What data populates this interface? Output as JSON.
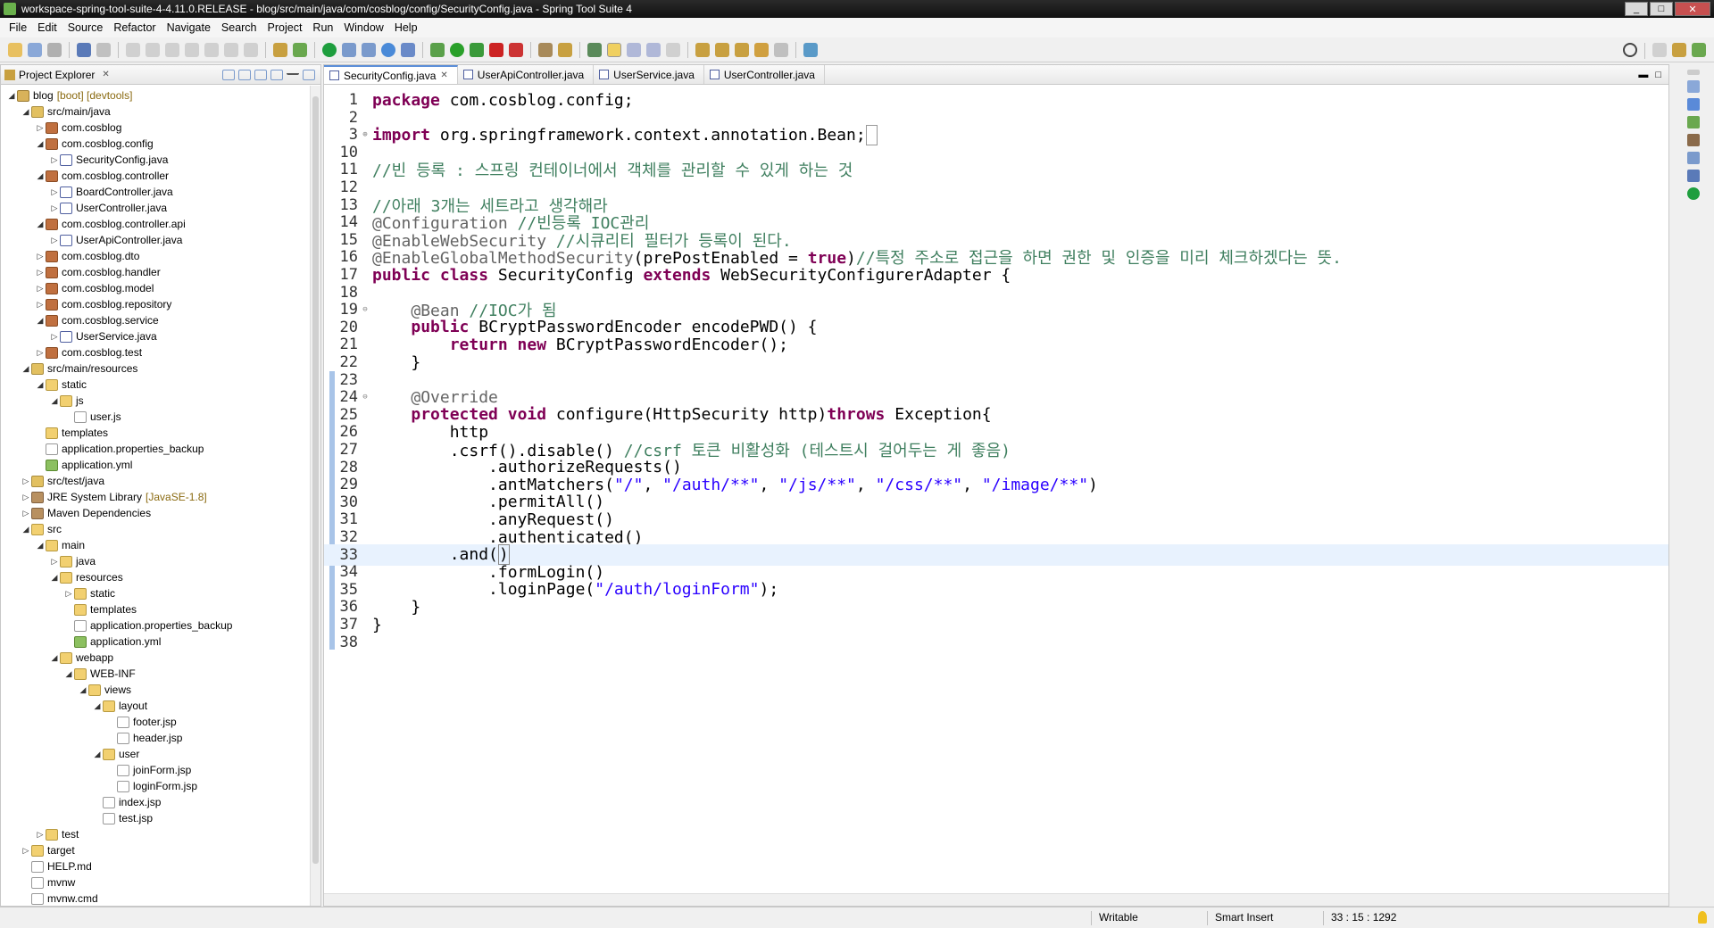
{
  "window": {
    "title": "workspace-spring-tool-suite-4-4.11.0.RELEASE - blog/src/main/java/com/cosblog/config/SecurityConfig.java - Spring Tool Suite 4"
  },
  "menu": [
    "File",
    "Edit",
    "Source",
    "Refactor",
    "Navigate",
    "Search",
    "Project",
    "Run",
    "Window",
    "Help"
  ],
  "explorer": {
    "title": "Project Explorer",
    "tree": [
      {
        "depth": 0,
        "arrow": "◢",
        "icon": "project",
        "label": "blog",
        "dec": "[boot] [devtools]"
      },
      {
        "depth": 1,
        "arrow": "◢",
        "icon": "srcfolder",
        "label": "src/main/java"
      },
      {
        "depth": 2,
        "arrow": "▷",
        "icon": "package",
        "label": "com.cosblog"
      },
      {
        "depth": 2,
        "arrow": "◢",
        "icon": "package",
        "label": "com.cosblog.config"
      },
      {
        "depth": 3,
        "arrow": "▷",
        "icon": "java",
        "label": "SecurityConfig.java"
      },
      {
        "depth": 2,
        "arrow": "◢",
        "icon": "package",
        "label": "com.cosblog.controller"
      },
      {
        "depth": 3,
        "arrow": "▷",
        "icon": "java",
        "label": "BoardController.java"
      },
      {
        "depth": 3,
        "arrow": "▷",
        "icon": "java",
        "label": "UserController.java"
      },
      {
        "depth": 2,
        "arrow": "◢",
        "icon": "package",
        "label": "com.cosblog.controller.api"
      },
      {
        "depth": 3,
        "arrow": "▷",
        "icon": "java",
        "label": "UserApiController.java"
      },
      {
        "depth": 2,
        "arrow": "▷",
        "icon": "package",
        "label": "com.cosblog.dto"
      },
      {
        "depth": 2,
        "arrow": "▷",
        "icon": "package",
        "label": "com.cosblog.handler"
      },
      {
        "depth": 2,
        "arrow": "▷",
        "icon": "package",
        "label": "com.cosblog.model"
      },
      {
        "depth": 2,
        "arrow": "▷",
        "icon": "package",
        "label": "com.cosblog.repository"
      },
      {
        "depth": 2,
        "arrow": "◢",
        "icon": "package",
        "label": "com.cosblog.service"
      },
      {
        "depth": 3,
        "arrow": "▷",
        "icon": "java",
        "label": "UserService.java"
      },
      {
        "depth": 2,
        "arrow": "▷",
        "icon": "package",
        "label": "com.cosblog.test"
      },
      {
        "depth": 1,
        "arrow": "◢",
        "icon": "srcfolder",
        "label": "src/main/resources"
      },
      {
        "depth": 2,
        "arrow": "◢",
        "icon": "folder",
        "label": "static"
      },
      {
        "depth": 3,
        "arrow": "◢",
        "icon": "folder",
        "label": "js"
      },
      {
        "depth": 4,
        "arrow": "",
        "icon": "file",
        "label": "user.js"
      },
      {
        "depth": 2,
        "arrow": "",
        "icon": "folder",
        "label": "templates"
      },
      {
        "depth": 2,
        "arrow": "",
        "icon": "file",
        "label": "application.properties_backup"
      },
      {
        "depth": 2,
        "arrow": "",
        "icon": "yml",
        "label": "application.yml"
      },
      {
        "depth": 1,
        "arrow": "▷",
        "icon": "srcfolder",
        "label": "src/test/java"
      },
      {
        "depth": 1,
        "arrow": "▷",
        "icon": "lib",
        "label": "JRE System Library",
        "dec": "[JavaSE-1.8]"
      },
      {
        "depth": 1,
        "arrow": "▷",
        "icon": "lib",
        "label": "Maven Dependencies"
      },
      {
        "depth": 1,
        "arrow": "◢",
        "icon": "folder",
        "label": "src"
      },
      {
        "depth": 2,
        "arrow": "◢",
        "icon": "folder",
        "label": "main"
      },
      {
        "depth": 3,
        "arrow": "▷",
        "icon": "folder",
        "label": "java"
      },
      {
        "depth": 3,
        "arrow": "◢",
        "icon": "folder",
        "label": "resources"
      },
      {
        "depth": 4,
        "arrow": "▷",
        "icon": "folder",
        "label": "static"
      },
      {
        "depth": 4,
        "arrow": "",
        "icon": "folder",
        "label": "templates"
      },
      {
        "depth": 4,
        "arrow": "",
        "icon": "file",
        "label": "application.properties_backup"
      },
      {
        "depth": 4,
        "arrow": "",
        "icon": "yml",
        "label": "application.yml"
      },
      {
        "depth": 3,
        "arrow": "◢",
        "icon": "folder",
        "label": "webapp"
      },
      {
        "depth": 4,
        "arrow": "◢",
        "icon": "folder",
        "label": "WEB-INF"
      },
      {
        "depth": 5,
        "arrow": "◢",
        "icon": "folder",
        "label": "views"
      },
      {
        "depth": 6,
        "arrow": "◢",
        "icon": "folder",
        "label": "layout"
      },
      {
        "depth": 7,
        "arrow": "",
        "icon": "file",
        "label": "footer.jsp"
      },
      {
        "depth": 7,
        "arrow": "",
        "icon": "file",
        "label": "header.jsp"
      },
      {
        "depth": 6,
        "arrow": "◢",
        "icon": "folder",
        "label": "user"
      },
      {
        "depth": 7,
        "arrow": "",
        "icon": "file",
        "label": "joinForm.jsp"
      },
      {
        "depth": 7,
        "arrow": "",
        "icon": "file",
        "label": "loginForm.jsp"
      },
      {
        "depth": 6,
        "arrow": "",
        "icon": "file",
        "label": "index.jsp"
      },
      {
        "depth": 6,
        "arrow": "",
        "icon": "file",
        "label": "test.jsp"
      },
      {
        "depth": 2,
        "arrow": "▷",
        "icon": "folder",
        "label": "test"
      },
      {
        "depth": 1,
        "arrow": "▷",
        "icon": "folder",
        "label": "target"
      },
      {
        "depth": 1,
        "arrow": "",
        "icon": "file",
        "label": "HELP.md"
      },
      {
        "depth": 1,
        "arrow": "",
        "icon": "file",
        "label": "mvnw"
      },
      {
        "depth": 1,
        "arrow": "",
        "icon": "file",
        "label": "mvnw.cmd"
      }
    ]
  },
  "editor": {
    "tabs": [
      {
        "label": "SecurityConfig.java",
        "active": true
      },
      {
        "label": "UserApiController.java",
        "active": false
      },
      {
        "label": "UserService.java",
        "active": false
      },
      {
        "label": "UserController.java",
        "active": false
      }
    ],
    "lines": [
      {
        "n": "1",
        "html": "<span class=\"kw\">package</span> com.cosblog.config;"
      },
      {
        "n": "2",
        "html": ""
      },
      {
        "n": "3",
        "fold": "⊕",
        "html": "<span class=\"kw\">import</span> org.springframework.context.annotation.Bean;<span style=\"border:1px solid #999\">&nbsp;</span>"
      },
      {
        "n": "10",
        "html": ""
      },
      {
        "n": "11",
        "html": "<span class=\"cm\">//빈 등록 : 스프링 컨테이너에서 객체를 관리할 수 있게 하는 것</span>"
      },
      {
        "n": "12",
        "html": ""
      },
      {
        "n": "13",
        "html": "<span class=\"cm\">//아래 3개는 세트라고 생각해라</span>"
      },
      {
        "n": "14",
        "html": "<span class=\"an\">@Configuration</span> <span class=\"cm\">//빈등록 IOC관리</span>"
      },
      {
        "n": "15",
        "html": "<span class=\"an\">@EnableWebSecurity</span> <span class=\"cm\">//시큐리티 필터가 등록이 된다.</span>"
      },
      {
        "n": "16",
        "html": "<span class=\"an\">@EnableGlobalMethodSecurity</span>(prePostEnabled = <span class=\"kw\">true</span>)<span class=\"cm\">//특정 주소로 접근을 하면 권한 및 인증을 미리 체크하겠다는 뜻.</span>"
      },
      {
        "n": "17",
        "html": "<span class=\"kw\">public class</span> SecurityConfig <span class=\"kw\">extends</span> WebSecurityConfigurerAdapter {"
      },
      {
        "n": "18",
        "html": ""
      },
      {
        "n": "19",
        "fold": "⊖",
        "html": "    <span class=\"an\">@Bean</span> <span class=\"cm\">//IOC가 됨</span>"
      },
      {
        "n": "20",
        "html": "    <span class=\"kw\">public</span> BCryptPasswordEncoder encodePWD() {"
      },
      {
        "n": "21",
        "html": "        <span class=\"kw\">return new</span> BCryptPasswordEncoder();"
      },
      {
        "n": "22",
        "html": "    }"
      },
      {
        "n": "23",
        "html": ""
      },
      {
        "n": "24",
        "fold": "⊖",
        "html": "    <span class=\"an\">@Override</span>"
      },
      {
        "n": "25",
        "html": "    <span class=\"kw\">protected void</span> configure(HttpSecurity http)<span class=\"kw\">throws</span> Exception{"
      },
      {
        "n": "26",
        "html": "        http"
      },
      {
        "n": "27",
        "html": "        .csrf().disable() <span class=\"cm\">//csrf 토큰 비활성화 (테스트시 걸어두는 게 좋음)</span>"
      },
      {
        "n": "28",
        "html": "            .authorizeRequests()"
      },
      {
        "n": "29",
        "html": "            .antMatchers(<span class=\"st\">\"/\"</span>, <span class=\"st\">\"/auth/**\"</span>, <span class=\"st\">\"/js/**\"</span>, <span class=\"st\">\"/css/**\"</span>, <span class=\"st\">\"/image/**\"</span>)"
      },
      {
        "n": "30",
        "html": "            .permitAll()"
      },
      {
        "n": "31",
        "html": "            .anyRequest()"
      },
      {
        "n": "32",
        "html": "            .authenticated()"
      },
      {
        "n": "33",
        "current": true,
        "html": "        .and(<span style=\"border:1px solid #888\">)</span>"
      },
      {
        "n": "34",
        "html": "            .formLogin()"
      },
      {
        "n": "35",
        "html": "            .loginPage(<span class=\"st\">\"/auth/loginForm\"</span>);"
      },
      {
        "n": "36",
        "html": "    }"
      },
      {
        "n": "37",
        "html": "}"
      },
      {
        "n": "38",
        "html": ""
      }
    ]
  },
  "status": {
    "mode": "Writable",
    "insert": "Smart Insert",
    "position": "33 : 15 : 1292"
  }
}
